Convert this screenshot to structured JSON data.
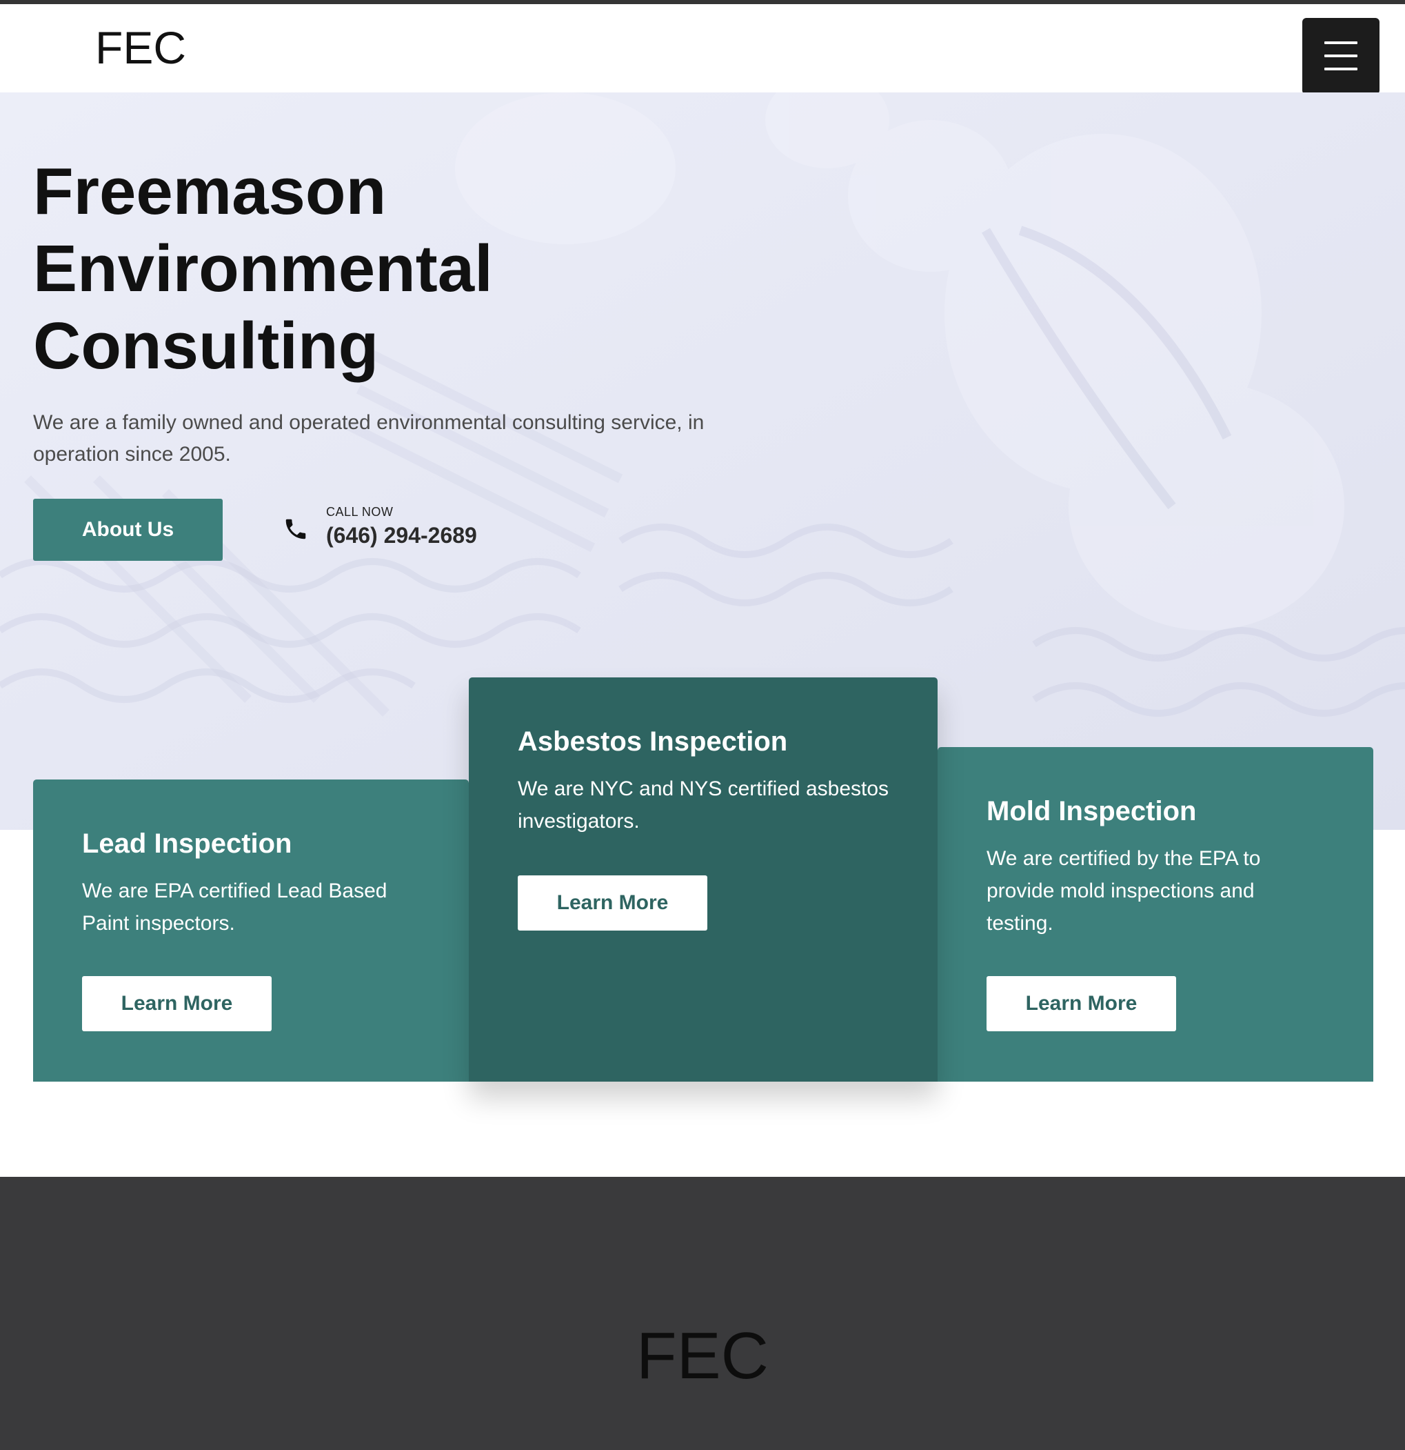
{
  "header": {
    "logo": "FEC",
    "menu_icon": "hamburger-menu-icon"
  },
  "hero": {
    "title_lines": [
      "Freemason",
      "Environmental",
      "Consulting"
    ],
    "description": "We are a family owned and operated environmental consulting service, in operation since 2005.",
    "about_label": "About Us",
    "call_label": "CALL NOW",
    "phone": "(646) 294-2689",
    "phone_icon": "phone-icon"
  },
  "services": [
    {
      "title": "Lead Inspection",
      "description": "We are EPA certified Lead Based Paint inspectors.",
      "button": "Learn More"
    },
    {
      "title": "Asbestos Inspection",
      "description": "We are NYC and NYS certified asbestos investigators.",
      "button": "Learn More"
    },
    {
      "title": "Mold Inspection",
      "description": "We are certified by the EPA to provide mold inspections and testing.",
      "button": "Learn More"
    }
  ],
  "footer": {
    "logo": "FEC"
  },
  "colors": {
    "accent": "#3d807c",
    "accent_dark": "#2e6461",
    "footer_bg": "#3a3a3c",
    "hero_overlay": "#e4e6f3"
  }
}
